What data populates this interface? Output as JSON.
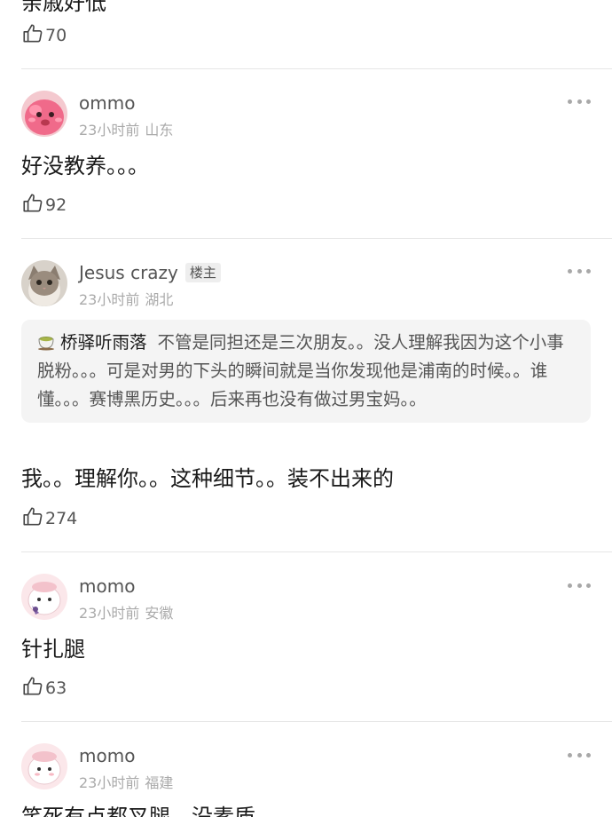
{
  "partial_comment": {
    "text_fragment": "亲戚好低",
    "likes": "70"
  },
  "comments": [
    {
      "username": "ommo",
      "time": "23小时前",
      "location": "山东",
      "text": "好没教养。。。",
      "likes": "92"
    },
    {
      "username": "Jesus crazy",
      "badge": "楼主",
      "time": "23小时前",
      "location": "湖北",
      "quote": {
        "name": "桥驿听雨落",
        "text": "不管是同担还是三次朋友。。没人理解我因为这个小事脱粉。。。可是对男的下头的瞬间就是当你发现他是浦南的时候。。谁懂。。。赛博黑历史。。。后来再也没有做过男宝妈。。"
      },
      "text": "我。。理解你。。这种细节。。装不出来的",
      "likes": "274"
    },
    {
      "username": "momo",
      "time": "23小时前",
      "location": "安徽",
      "text": "针扎腿",
      "likes": "63"
    },
    {
      "username": "momo",
      "time": "23小时前",
      "location": "福建",
      "text": "笑死有点都叉腿，没素质"
    }
  ],
  "icons": {
    "like": "thumbs-up-icon",
    "more": "more-dots-icon",
    "tea": "tea-cup-icon"
  },
  "colors": {
    "text": "#1a1a1a",
    "username": "#555555",
    "meta": "#aaaaaa",
    "quote_bg": "#f4f4f4",
    "divider": "#e6e6e6"
  }
}
